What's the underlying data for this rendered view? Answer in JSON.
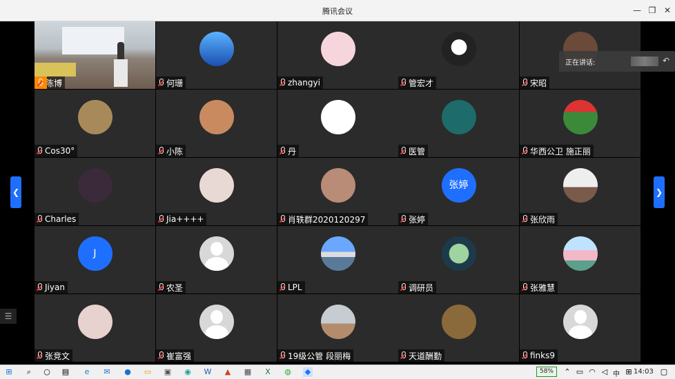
{
  "window": {
    "title": "腾讯会议"
  },
  "speaking": {
    "label": "正在讲话:"
  },
  "participants": [
    {
      "name": "陈博"
    },
    {
      "name": "何珊"
    },
    {
      "name": "zhangyi"
    },
    {
      "name": "管宏才"
    },
    {
      "name": "宋昭"
    },
    {
      "name": "Cos30°"
    },
    {
      "name": "小陈"
    },
    {
      "name": "丹"
    },
    {
      "name": "医管"
    },
    {
      "name": "华西公卫 施正丽"
    },
    {
      "name": "Charles"
    },
    {
      "name": "Jia++++"
    },
    {
      "name": "肖轶群2020120297"
    },
    {
      "name": "张婷",
      "avatar_text": "张婷"
    },
    {
      "name": "张欣雨"
    },
    {
      "name": "Jiyan",
      "avatar_text": "J"
    },
    {
      "name": "农圣"
    },
    {
      "name": "LPL"
    },
    {
      "name": "调研员"
    },
    {
      "name": "张雅慧"
    },
    {
      "name": "张竞文"
    },
    {
      "name": "崔富强"
    },
    {
      "name": "19级公管 段丽梅"
    },
    {
      "name": "天道酬勤"
    },
    {
      "name": "finks9"
    }
  ],
  "taskbar": {
    "battery": "58%",
    "ime": "中",
    "time": "14:03"
  },
  "colors": {
    "accent": "#1f6fff",
    "tile": "#2b2b2b"
  }
}
